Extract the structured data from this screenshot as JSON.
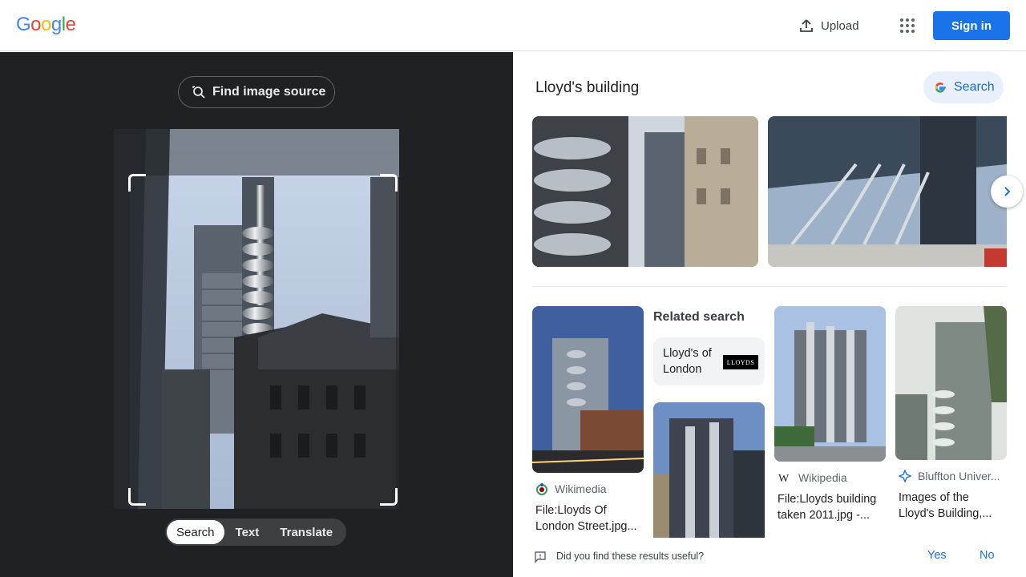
{
  "header": {
    "logo_text": [
      "G",
      "o",
      "o",
      "g",
      "l",
      "e"
    ],
    "logo_colors": [
      "#4285F4",
      "#EA4335",
      "#FBBC05",
      "#4285F4",
      "#34A853",
      "#EA4335"
    ],
    "upload_label": "Upload",
    "sign_in_label": "Sign in"
  },
  "left_panel": {
    "find_image_source_label": "Find image source",
    "modes": [
      "Search",
      "Text",
      "Translate"
    ],
    "active_mode": "Search"
  },
  "right_panel": {
    "title": "Lloyd's building",
    "search_button_label": "Search",
    "related_search_heading": "Related search",
    "related_search_item": "Lloyd's of London",
    "related_logo_text": "LLOYDS",
    "results": [
      {
        "source": "Wikimedia",
        "caption": "File:Lloyds Of London Street.jpg..."
      },
      {
        "source": "Wikipedia",
        "caption": "File:Lloyds building taken 2011.jpg -..."
      },
      {
        "source": "Bluffton Univer...",
        "caption": "Images of the Lloyd's Building,..."
      }
    ],
    "feedback_question": "Did you find these results useful?",
    "feedback_yes": "Yes",
    "feedback_no": "No"
  },
  "colors": {
    "accent": "#1a73e8",
    "left_panel_bg": "#202124"
  }
}
